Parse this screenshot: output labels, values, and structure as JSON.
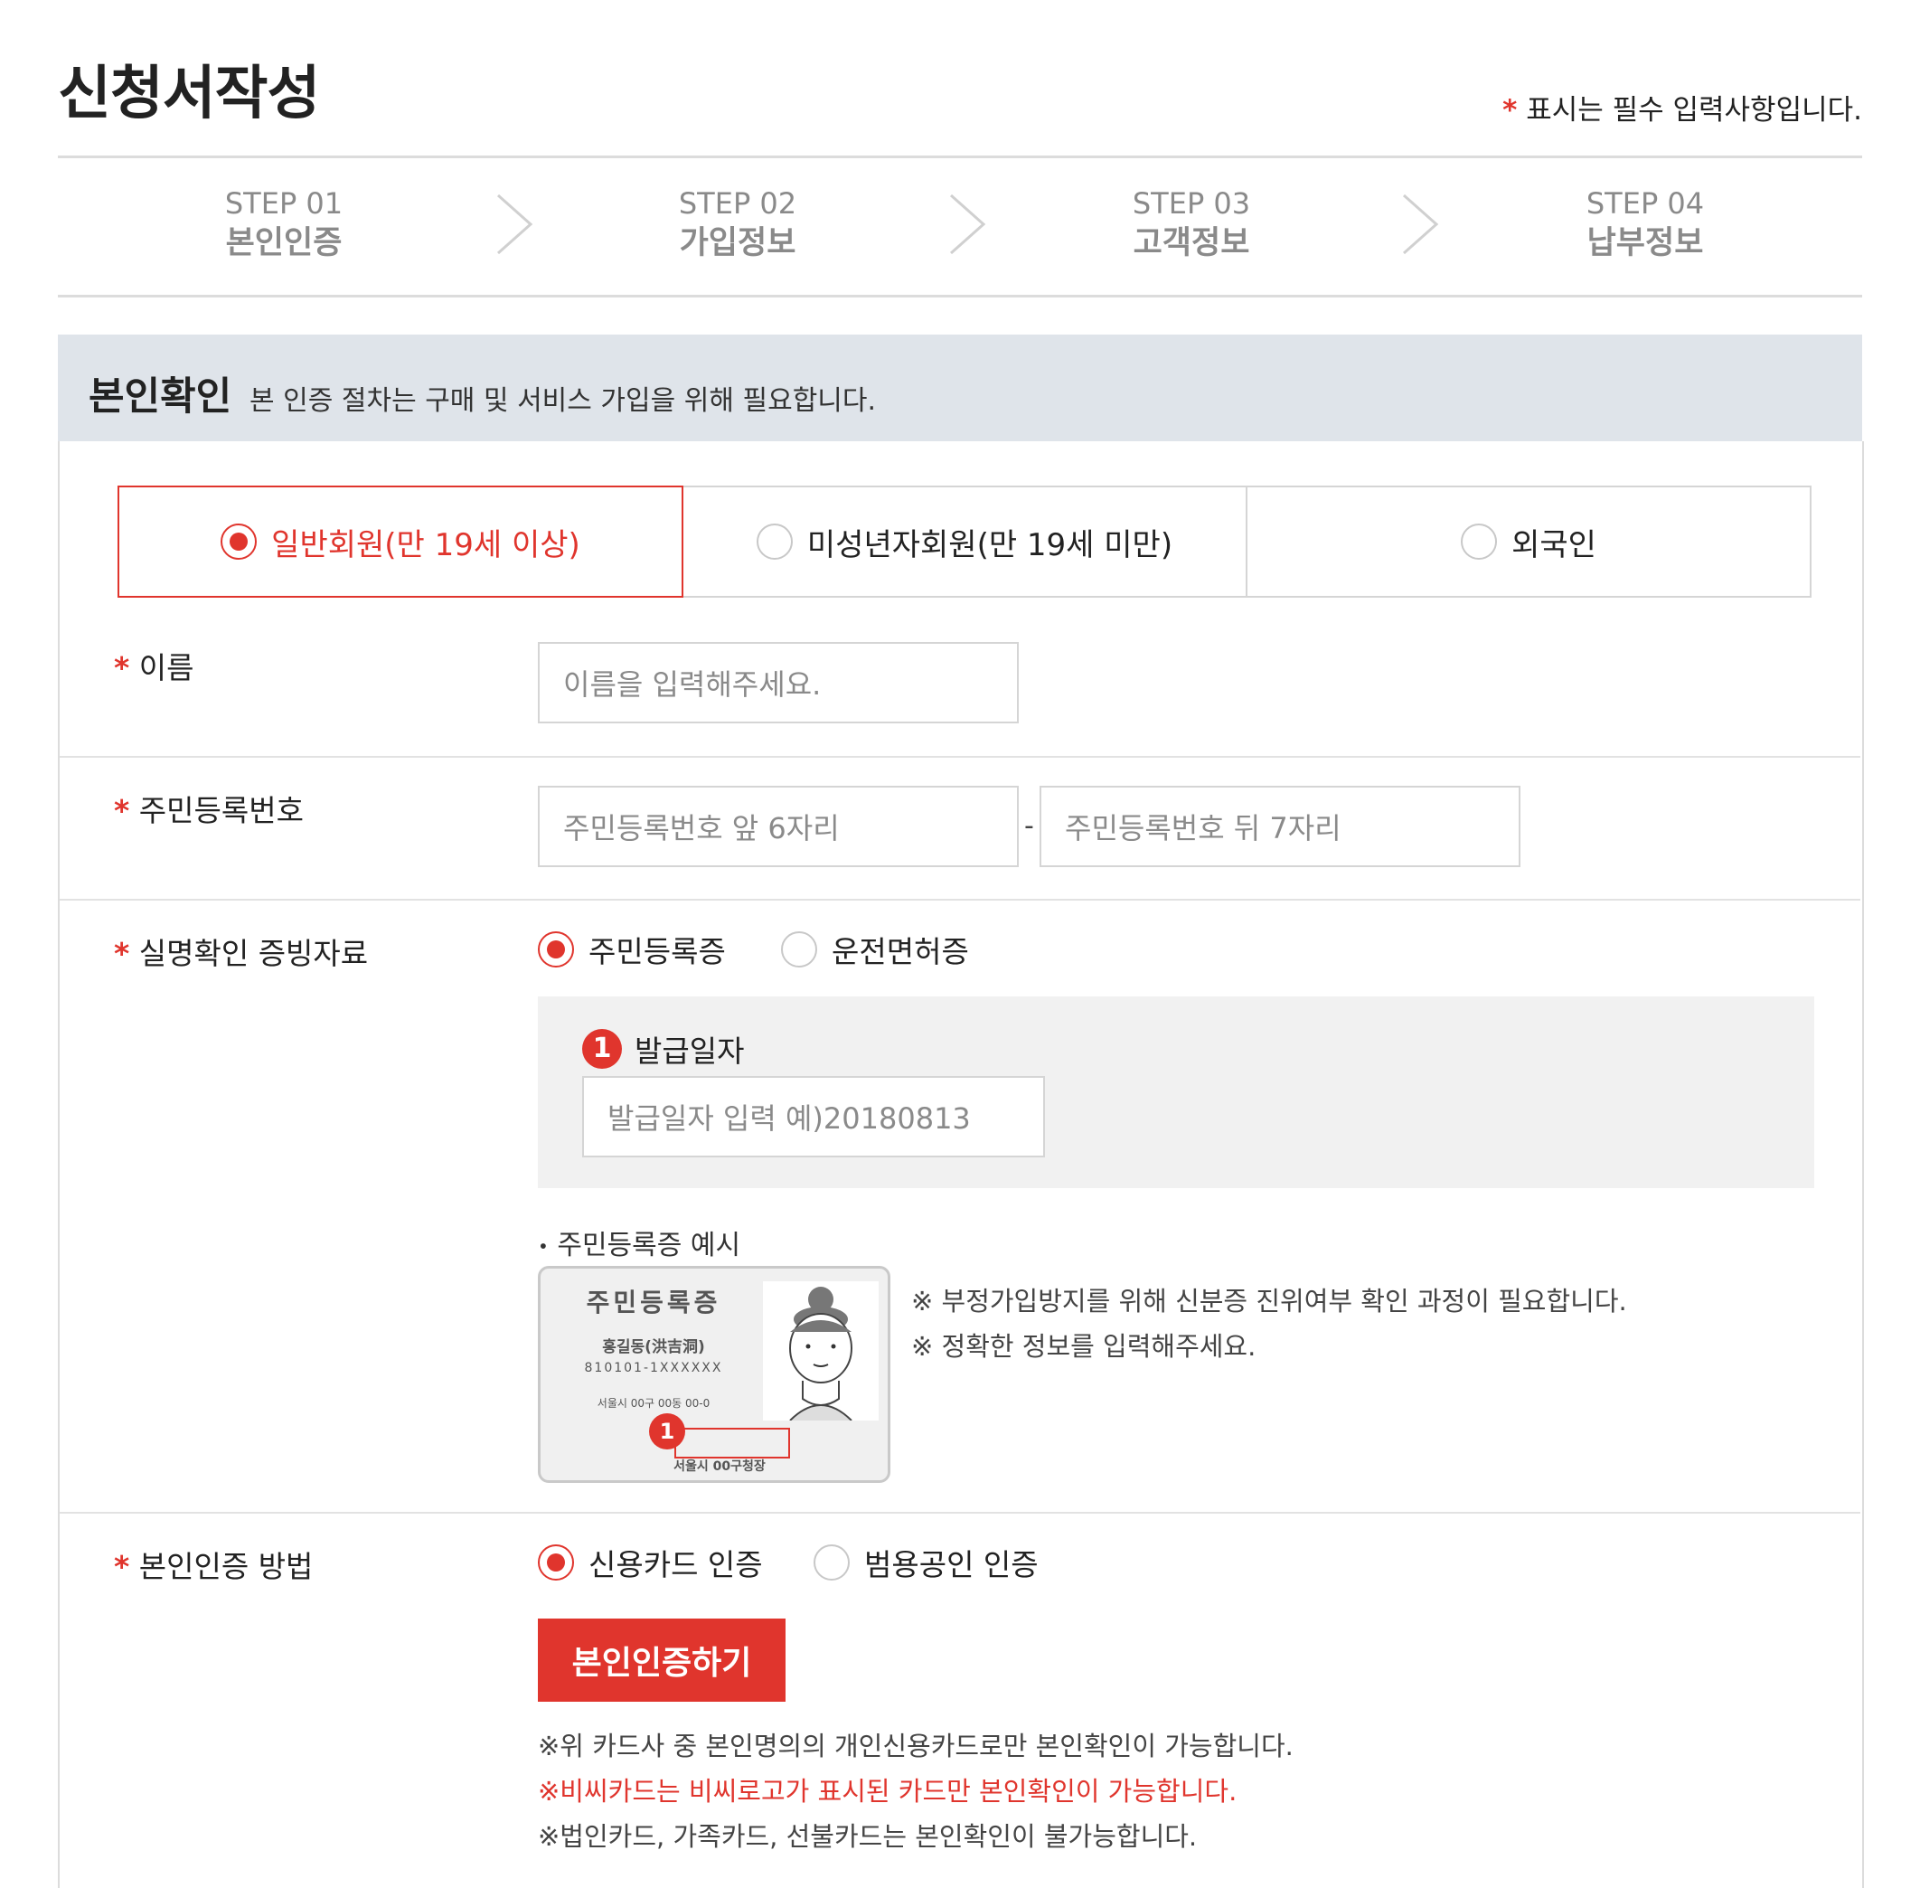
{
  "header": {
    "title": "신청서작성",
    "required_mark": "*",
    "required_note": "표시는 필수 입력사항입니다."
  },
  "steps": [
    {
      "num": "STEP 01",
      "label": "본인인증"
    },
    {
      "num": "STEP 02",
      "label": "가입정보"
    },
    {
      "num": "STEP 03",
      "label": "고객정보"
    },
    {
      "num": "STEP 04",
      "label": "납부정보"
    }
  ],
  "section": {
    "title": "본인확인",
    "description": "본 인증 절차는 구매 및 서비스 가입을 위해 필요합니다."
  },
  "member_tabs": [
    {
      "label": "일반회원(만 19세 이상)",
      "selected": true
    },
    {
      "label": "미성년자회원(만 19세 미만)",
      "selected": false
    },
    {
      "label": "외국인",
      "selected": false
    }
  ],
  "form": {
    "name": {
      "label": "이름",
      "placeholder": "이름을 입력해주세요."
    },
    "rrn": {
      "label": "주민등록번호",
      "front_placeholder": "주민등록번호 앞 6자리",
      "separator": "-",
      "back_placeholder": "주민등록번호 뒤 7자리"
    },
    "id_proof": {
      "label": "실명확인 증빙자료",
      "options": [
        {
          "label": "주민등록증",
          "selected": true
        },
        {
          "label": "운전면허증",
          "selected": false
        }
      ],
      "issue_badge": "1",
      "issue_label": "발급일자",
      "issue_placeholder": "발급일자 입력 예)20180813",
      "example_title": "주민등록증 예시",
      "card": {
        "title": "주민등록증",
        "name": "홍길동(洪吉洞)",
        "number": "810101-1XXXXXX",
        "address": "서울시 00구 00동 00-0",
        "badge": "1",
        "issuer": "서울시 00구청장"
      },
      "notes": [
        "※ 부정가입방지를 위해 신분증 진위여부 확인 과정이 필요합니다.",
        "※ 정확한 정보를 입력해주세요."
      ]
    },
    "auth_method": {
      "label": "본인인증 방법",
      "options": [
        {
          "label": "신용카드 인증",
          "selected": true
        },
        {
          "label": "범용공인 인증",
          "selected": false
        }
      ],
      "button": "본인인증하기",
      "notes": [
        "※위 카드사 중 본인명의의 개인신용카드로만 본인확인이 가능합니다.",
        "※비씨카드는 비씨로고가 표시된 카드만 본인확인이 가능합니다.",
        "※법인카드, 가족카드, 선불카드는 본인확인이 불가능합니다."
      ]
    }
  },
  "colors": {
    "accent": "#e0352d",
    "section_bg": "#dfe4ea",
    "box_bg": "#f1f1f1"
  }
}
